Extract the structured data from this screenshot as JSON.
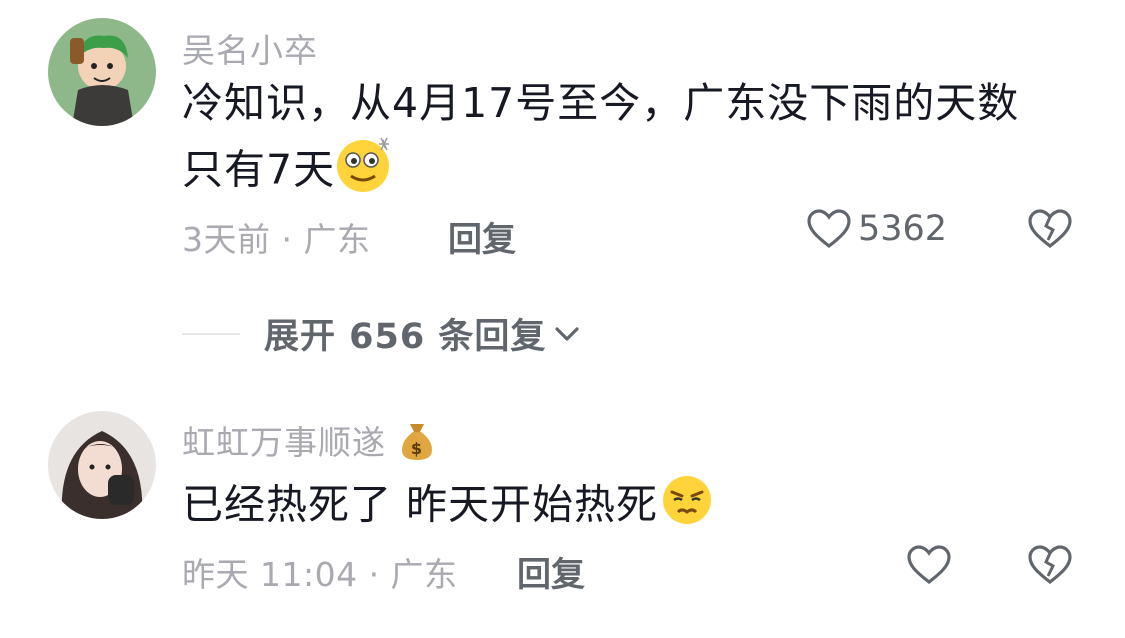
{
  "comments": [
    {
      "username": "吴名小卒",
      "text_line1": "冷知识，从4月17号至今，广东没下雨的天数",
      "text_line2": "只有7天",
      "emoji": "dizzy-smile-emoji",
      "meta": "3天前 · 广东",
      "reply_label": "回复",
      "like_count": "5362"
    },
    {
      "username": "虹虹万事顺遂",
      "username_emoji": "money-bag-emoji",
      "text": "已经热死了 昨天开始热死",
      "emoji": "sweating-annoyed-emoji",
      "meta": "昨天 11:04 · 广东",
      "reply_label": "回复",
      "like_count": ""
    }
  ],
  "expand_replies_label": "展开 656 条回复",
  "colors": {
    "primary_text": "#161823",
    "secondary_text": "#a9a9b1",
    "action_text": "#61666d"
  }
}
